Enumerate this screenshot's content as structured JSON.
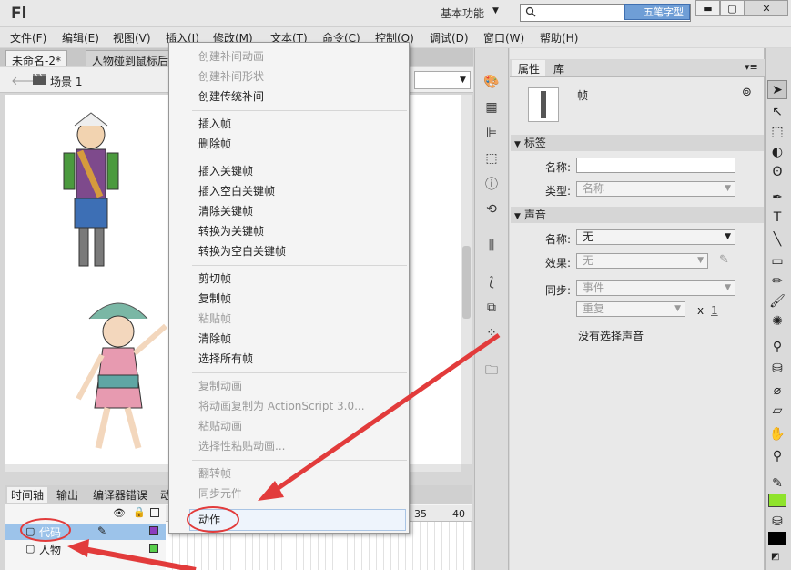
{
  "app": {
    "logo": "Fl",
    "workspace": "基本功能",
    "watermark": "五笔字型"
  },
  "menu": [
    "文件(F)",
    "编辑(E)",
    "视图(V)",
    "插入(I)",
    "修改(M)",
    "文本(T)",
    "命令(C)",
    "控制(O)",
    "调试(D)",
    "窗口(W)",
    "帮助(H)"
  ],
  "doc_tabs": [
    "未命名-2*",
    "人物碰到鼠标后"
  ],
  "scene": "场景 1",
  "timeline": {
    "tabs": [
      "时间轴",
      "输出",
      "编译器错误",
      "动"
    ],
    "ruler_marks": [
      "35",
      "40"
    ],
    "layers": [
      {
        "name": "代码"
      },
      {
        "name": "人物"
      }
    ]
  },
  "context_menu": {
    "group1": [
      {
        "label": "创建补间动画",
        "disabled": true
      },
      {
        "label": "创建补间形状",
        "disabled": true
      },
      {
        "label": "创建传统补间",
        "disabled": false
      }
    ],
    "group2": [
      {
        "label": "插入帧",
        "disabled": false
      },
      {
        "label": "删除帧",
        "disabled": false
      }
    ],
    "group3": [
      {
        "label": "插入关键帧",
        "disabled": false
      },
      {
        "label": "插入空白关键帧",
        "disabled": false
      },
      {
        "label": "清除关键帧",
        "disabled": false
      },
      {
        "label": "转换为关键帧",
        "disabled": false
      },
      {
        "label": "转换为空白关键帧",
        "disabled": false
      }
    ],
    "group4": [
      {
        "label": "剪切帧",
        "disabled": false
      },
      {
        "label": "复制帧",
        "disabled": false
      },
      {
        "label": "粘贴帧",
        "disabled": true
      },
      {
        "label": "清除帧",
        "disabled": false
      },
      {
        "label": "选择所有帧",
        "disabled": false
      }
    ],
    "group5": [
      {
        "label": "复制动画",
        "disabled": true
      },
      {
        "label": "将动画复制为 ActionScript 3.0...",
        "disabled": true
      },
      {
        "label": "粘贴动画",
        "disabled": true
      },
      {
        "label": "选择性粘贴动画...",
        "disabled": true
      }
    ],
    "group6": [
      {
        "label": "翻转帧",
        "disabled": true
      },
      {
        "label": "同步元件",
        "disabled": true
      }
    ],
    "action": "动作"
  },
  "properties": {
    "tabs": [
      "属性",
      "库"
    ],
    "frame_label": "帧",
    "section_label": "标签",
    "name_label": "名称:",
    "type_label": "类型:",
    "type_value": "名称",
    "section_sound": "声音",
    "sound_name_label": "名称:",
    "sound_name_value": "无",
    "effect_label": "效果:",
    "effect_value": "无",
    "sync_label": "同步:",
    "sync_value": "事件",
    "repeat_value": "重复",
    "times_label": "x",
    "times_value": "1",
    "no_sound": "没有选择声音"
  },
  "colors": {
    "accent": "#e23b3b",
    "fill": "#8fe32c",
    "stroke": "#000000",
    "selected_layer": "#9cc3ea"
  }
}
